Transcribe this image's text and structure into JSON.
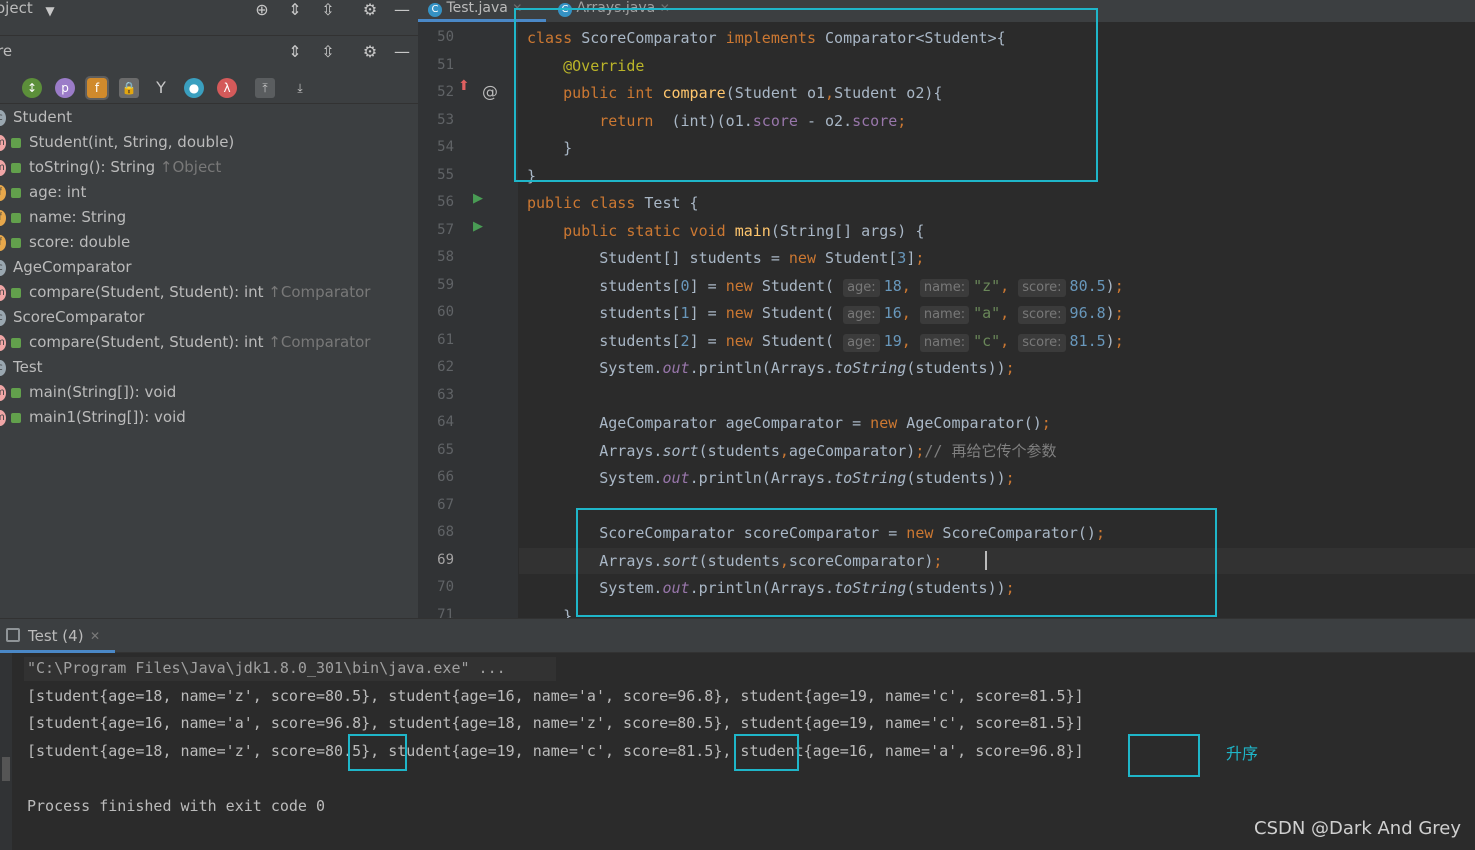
{
  "project_panel": {
    "top_label": "oject",
    "second_label": "re"
  },
  "structure_tree": [
    {
      "label": "Student",
      "indent": 0,
      "lead": "c",
      "lead_color": "#9aa7b0"
    },
    {
      "label": "Student(int, String, double)",
      "indent": 1,
      "lead": "m",
      "lead_color": "#f0a6a6"
    },
    {
      "label": "toString(): String ",
      "suffix": "↑Object",
      "indent": 1,
      "lead": "m",
      "lead_color": "#f0a6a6"
    },
    {
      "label": "age: int",
      "indent": 1,
      "lead": "f",
      "lead_color": "#e7a84b"
    },
    {
      "label": "name: String",
      "indent": 1,
      "lead": "f",
      "lead_color": "#e7a84b"
    },
    {
      "label": "score: double",
      "indent": 1,
      "lead": "f",
      "lead_color": "#e7a84b"
    },
    {
      "label": "AgeComparator",
      "indent": 0,
      "lead": "c",
      "lead_color": "#9aa7b0"
    },
    {
      "label": "compare(Student, Student): int ",
      "suffix": "↑Comparator",
      "indent": 1,
      "lead": "m",
      "lead_color": "#f0a6a6"
    },
    {
      "label": "ScoreComparator",
      "indent": 0,
      "lead": "c",
      "lead_color": "#9aa7b0"
    },
    {
      "label": "compare(Student, Student): int ",
      "suffix": "↑Comparator",
      "indent": 1,
      "lead": "m",
      "lead_color": "#f0a6a6"
    },
    {
      "label": "Test",
      "indent": 0,
      "lead": "c",
      "lead_color": "#9aa7b0"
    },
    {
      "label": "main(String[]): void",
      "indent": 1,
      "lead": "m",
      "lead_color": "#f0a6a6"
    },
    {
      "label": "main1(String[]): void",
      "indent": 1,
      "lead": "m",
      "lead_color": "#f0a6a6"
    }
  ],
  "tabs": [
    {
      "label": "Test.java",
      "active": true
    },
    {
      "label": "Arrays.java",
      "active": false
    }
  ],
  "line_numbers": [
    "50",
    "51",
    "52",
    "53",
    "54",
    "55",
    "56",
    "57",
    "58",
    "59",
    "60",
    "61",
    "62",
    "63",
    "64",
    "65",
    "66",
    "67",
    "68",
    "69",
    "70",
    "71"
  ],
  "code_lines": [
    [
      [
        "kw",
        "class "
      ],
      [
        "",
        "ScoreComparator "
      ],
      [
        "kw",
        "implements "
      ],
      [
        "",
        "Comparator<Student>{"
      ]
    ],
    [
      [
        "",
        "    "
      ],
      [
        "an",
        "@Override"
      ]
    ],
    [
      [
        "",
        "    "
      ],
      [
        "kw",
        "public int "
      ],
      [
        "fn",
        "compare"
      ],
      [
        "",
        "(Student o1"
      ],
      [
        "kw",
        ","
      ],
      [
        "",
        "Student o2){"
      ]
    ],
    [
      [
        "",
        "        "
      ],
      [
        "kw",
        "return  "
      ],
      [
        "",
        "(int)(o1."
      ],
      [
        "fld",
        "score"
      ],
      [
        "",
        " - o2."
      ],
      [
        "fld",
        "score"
      ],
      [
        "kw",
        ";"
      ]
    ],
    [
      [
        "",
        "    }"
      ]
    ],
    [
      [
        "",
        "}"
      ]
    ],
    [
      [
        "kw",
        "public class "
      ],
      [
        "",
        "Test {"
      ]
    ],
    [
      [
        "",
        "    "
      ],
      [
        "kw",
        "public static void "
      ],
      [
        "fn",
        "main"
      ],
      [
        "",
        "(String[] args) {"
      ]
    ],
    [
      [
        "",
        "        Student[] students = "
      ],
      [
        "kw",
        "new "
      ],
      [
        "",
        "Student["
      ],
      [
        "num",
        "3"
      ],
      [
        "",
        "]"
      ],
      [
        "kw",
        ";"
      ]
    ],
    [
      [
        "",
        "        students["
      ],
      [
        "num",
        "0"
      ],
      [
        "",
        "] = "
      ],
      [
        "kw",
        "new "
      ],
      [
        "",
        "Student( "
      ],
      [
        "hint",
        "age:"
      ],
      [
        "num",
        "18"
      ],
      [
        "kw",
        ", "
      ],
      [
        "hint",
        "name:"
      ],
      [
        "str",
        "\"z\""
      ],
      [
        "kw",
        ", "
      ],
      [
        "hint",
        "score:"
      ],
      [
        "num",
        "80.5"
      ],
      [
        "",
        ")"
      ],
      [
        "kw",
        ";"
      ]
    ],
    [
      [
        "",
        "        students["
      ],
      [
        "num",
        "1"
      ],
      [
        "",
        "] = "
      ],
      [
        "kw",
        "new "
      ],
      [
        "",
        "Student( "
      ],
      [
        "hint",
        "age:"
      ],
      [
        "num",
        "16"
      ],
      [
        "kw",
        ", "
      ],
      [
        "hint",
        "name:"
      ],
      [
        "str",
        "\"a\""
      ],
      [
        "kw",
        ", "
      ],
      [
        "hint",
        "score:"
      ],
      [
        "num",
        "96.8"
      ],
      [
        "",
        ")"
      ],
      [
        "kw",
        ";"
      ]
    ],
    [
      [
        "",
        "        students["
      ],
      [
        "num",
        "2"
      ],
      [
        "",
        "] = "
      ],
      [
        "kw",
        "new "
      ],
      [
        "",
        "Student( "
      ],
      [
        "hint",
        "age:"
      ],
      [
        "num",
        "19"
      ],
      [
        "kw",
        ", "
      ],
      [
        "hint",
        "name:"
      ],
      [
        "str",
        "\"c\""
      ],
      [
        "kw",
        ", "
      ],
      [
        "hint",
        "score:"
      ],
      [
        "num",
        "81.5"
      ],
      [
        "",
        ")"
      ],
      [
        "kw",
        ";"
      ]
    ],
    [
      [
        "",
        "        System."
      ],
      [
        "fld it",
        "out"
      ],
      [
        "",
        ".println(Arrays."
      ],
      [
        "it",
        "toString"
      ],
      [
        "",
        "(students))"
      ],
      [
        "kw",
        ";"
      ]
    ],
    [
      [
        "",
        ""
      ]
    ],
    [
      [
        "",
        "        AgeComparator ageComparator = "
      ],
      [
        "kw",
        "new "
      ],
      [
        "",
        "AgeComparator()"
      ],
      [
        "kw",
        ";"
      ]
    ],
    [
      [
        "",
        "        Arrays."
      ],
      [
        "it",
        "sort"
      ],
      [
        "",
        "(students"
      ],
      [
        "kw",
        ","
      ],
      [
        "",
        "ageComparator)"
      ],
      [
        "kw",
        ";"
      ],
      [
        "cm",
        "// 再给它传个参数"
      ]
    ],
    [
      [
        "",
        "        System."
      ],
      [
        "fld it",
        "out"
      ],
      [
        "",
        ".println(Arrays."
      ],
      [
        "it",
        "toString"
      ],
      [
        "",
        "(students))"
      ],
      [
        "kw",
        ";"
      ]
    ],
    [
      [
        "",
        ""
      ]
    ],
    [
      [
        "",
        "        ScoreComparator scoreComparator = "
      ],
      [
        "kw",
        "new "
      ],
      [
        "",
        "ScoreComparator()"
      ],
      [
        "kw",
        ";"
      ]
    ],
    [
      [
        "",
        "        Arrays."
      ],
      [
        "it",
        "sort"
      ],
      [
        "",
        "(students"
      ],
      [
        "kw",
        ","
      ],
      [
        "",
        "scoreComparator)"
      ],
      [
        "kw",
        ";"
      ]
    ],
    [
      [
        "",
        "        System."
      ],
      [
        "fld it",
        "out"
      ],
      [
        "",
        ".println(Arrays."
      ],
      [
        "it",
        "toString"
      ],
      [
        "",
        "(students))"
      ],
      [
        "kw",
        ";"
      ]
    ],
    [
      [
        "",
        "    }"
      ]
    ]
  ],
  "run_panel": {
    "tab_label": "Test (4)",
    "command": "\"C:\\Program Files\\Java\\jdk1.8.0_301\\bin\\java.exe\" ...",
    "output_lines": [
      "[student{age=18, name='z', score=80.5}, student{age=16, name='a', score=96.8}, student{age=19, name='c', score=81.5}]",
      "[student{age=16, name='a', score=96.8}, student{age=18, name='z', score=80.5}, student{age=19, name='c', score=81.5}]",
      "[student{age=18, name='z', score=80.5}, student{age=19, name='c', score=81.5}, student{age=16, name='a', score=96.8}]"
    ],
    "exit_message": "Process finished with exit code 0",
    "annotation": "升序"
  },
  "watermark": "CSDN @Dark And Grey",
  "colors": {
    "accent_box": "#1fb6c9",
    "annotation": "#1fb6c9"
  }
}
